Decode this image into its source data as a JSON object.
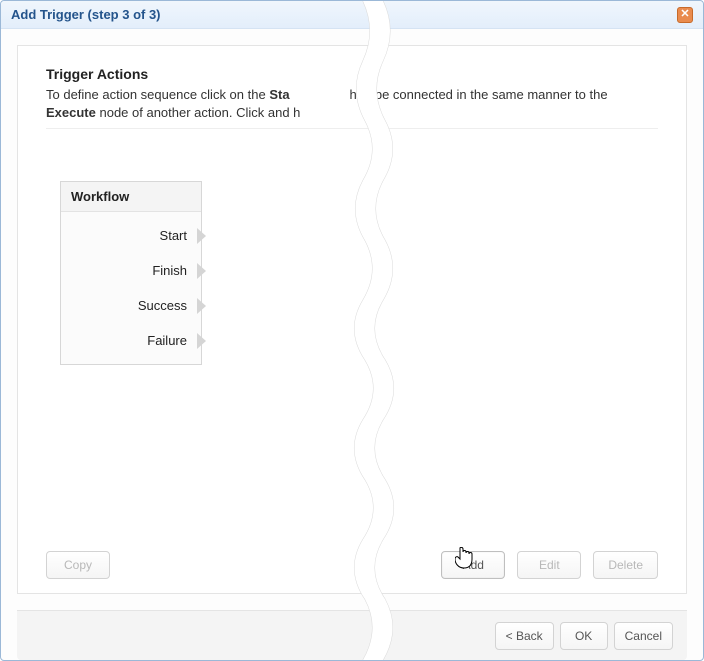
{
  "dialog": {
    "title": "Add Trigger (step 3 of 3)"
  },
  "section": {
    "heading": "Trigger Actions",
    "instruction_pre": "To define action sequence click on the ",
    "instruction_bold1": "Sta",
    "instruction_mid": "hen be connected in the same manner to the ",
    "instruction_bold2": "Execute",
    "instruction_post": " node of another action. Click and h"
  },
  "workflow": {
    "header": "Workflow",
    "nodes": [
      "Start",
      "Finish",
      "Success",
      "Failure"
    ]
  },
  "panel_buttons": {
    "copy": "Copy",
    "add": "Add",
    "edit": "Edit",
    "delete": "Delete"
  },
  "footer": {
    "back": "< Back",
    "ok": "OK",
    "cancel": "Cancel"
  }
}
